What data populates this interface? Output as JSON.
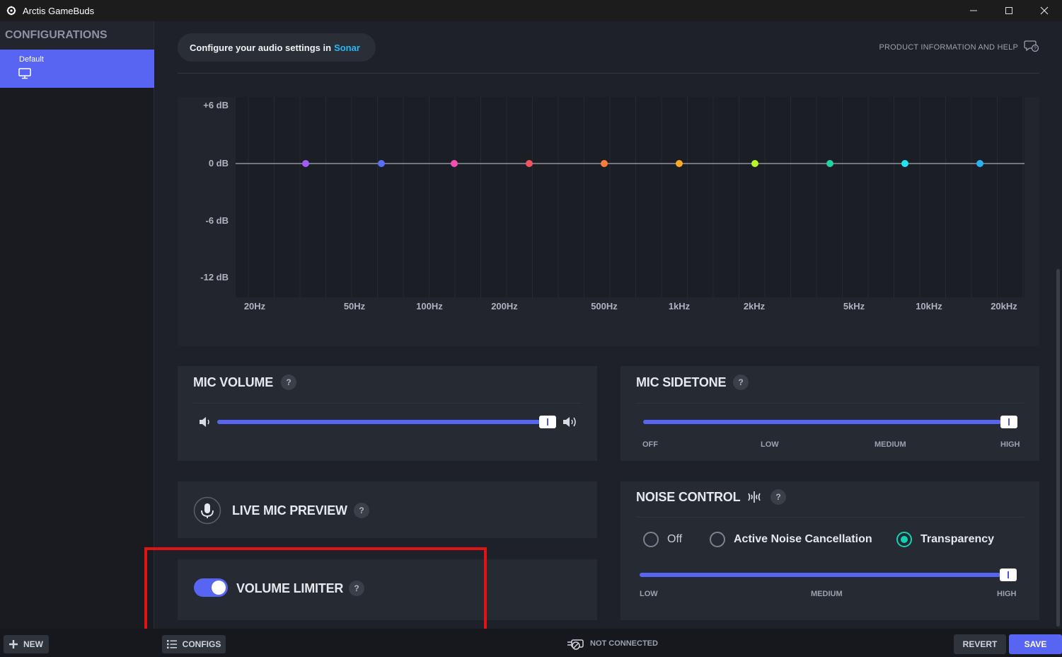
{
  "window": {
    "title": "Arctis GameBuds"
  },
  "sidebar": {
    "header": "CONFIGURATIONS",
    "configs": [
      {
        "name": "Default",
        "icon": "monitor-icon"
      }
    ]
  },
  "topbar": {
    "sonar_text": "Configure your audio settings in",
    "sonar_link": "Sonar",
    "product_help": "PRODUCT INFORMATION AND HELP"
  },
  "equalizer": {
    "db_labels": [
      "+6 dB",
      "0 dB",
      "-6 dB",
      "-12 dB"
    ],
    "freq_labels": [
      "20Hz",
      "50Hz",
      "100Hz",
      "200Hz",
      "500Hz",
      "1kHz",
      "2kHz",
      "5kHz",
      "10kHz",
      "20kHz"
    ],
    "band_colors": [
      "#a05cf5",
      "#5b6cf6",
      "#f54fb2",
      "#f2545f",
      "#ff7a3d",
      "#ffa628",
      "#b6f52c",
      "#22d3a0",
      "#22e5f0",
      "#2ab0f5"
    ]
  },
  "mic_volume": {
    "title": "MIC VOLUME",
    "help": "?",
    "level": 0.99
  },
  "mic_sidetone": {
    "title": "MIC SIDETONE",
    "help": "?",
    "labels": [
      "OFF",
      "LOW",
      "MEDIUM",
      "HIGH"
    ],
    "selected": "HIGH"
  },
  "live_mic_preview": {
    "title": "LIVE MIC PREVIEW",
    "help": "?"
  },
  "volume_limiter": {
    "title": "VOLUME LIMITER",
    "help": "?",
    "enabled": true
  },
  "noise_control": {
    "title": "NOISE CONTROL",
    "help": "?",
    "options": [
      "Off",
      "Active Noise Cancellation",
      "Transparency"
    ],
    "selected": "Transparency",
    "level_labels": [
      "LOW",
      "MEDIUM",
      "HIGH"
    ],
    "level_selected": "HIGH"
  },
  "footer": {
    "new_label": "NEW",
    "configs_label": "CONFIGS",
    "status": "NOT CONNECTED",
    "revert_label": "REVERT",
    "save_label": "SAVE"
  },
  "colors": {
    "accent": "#5865f2",
    "teal": "#15d1b4",
    "link": "#29b6f6",
    "highlight": "#e11414"
  }
}
